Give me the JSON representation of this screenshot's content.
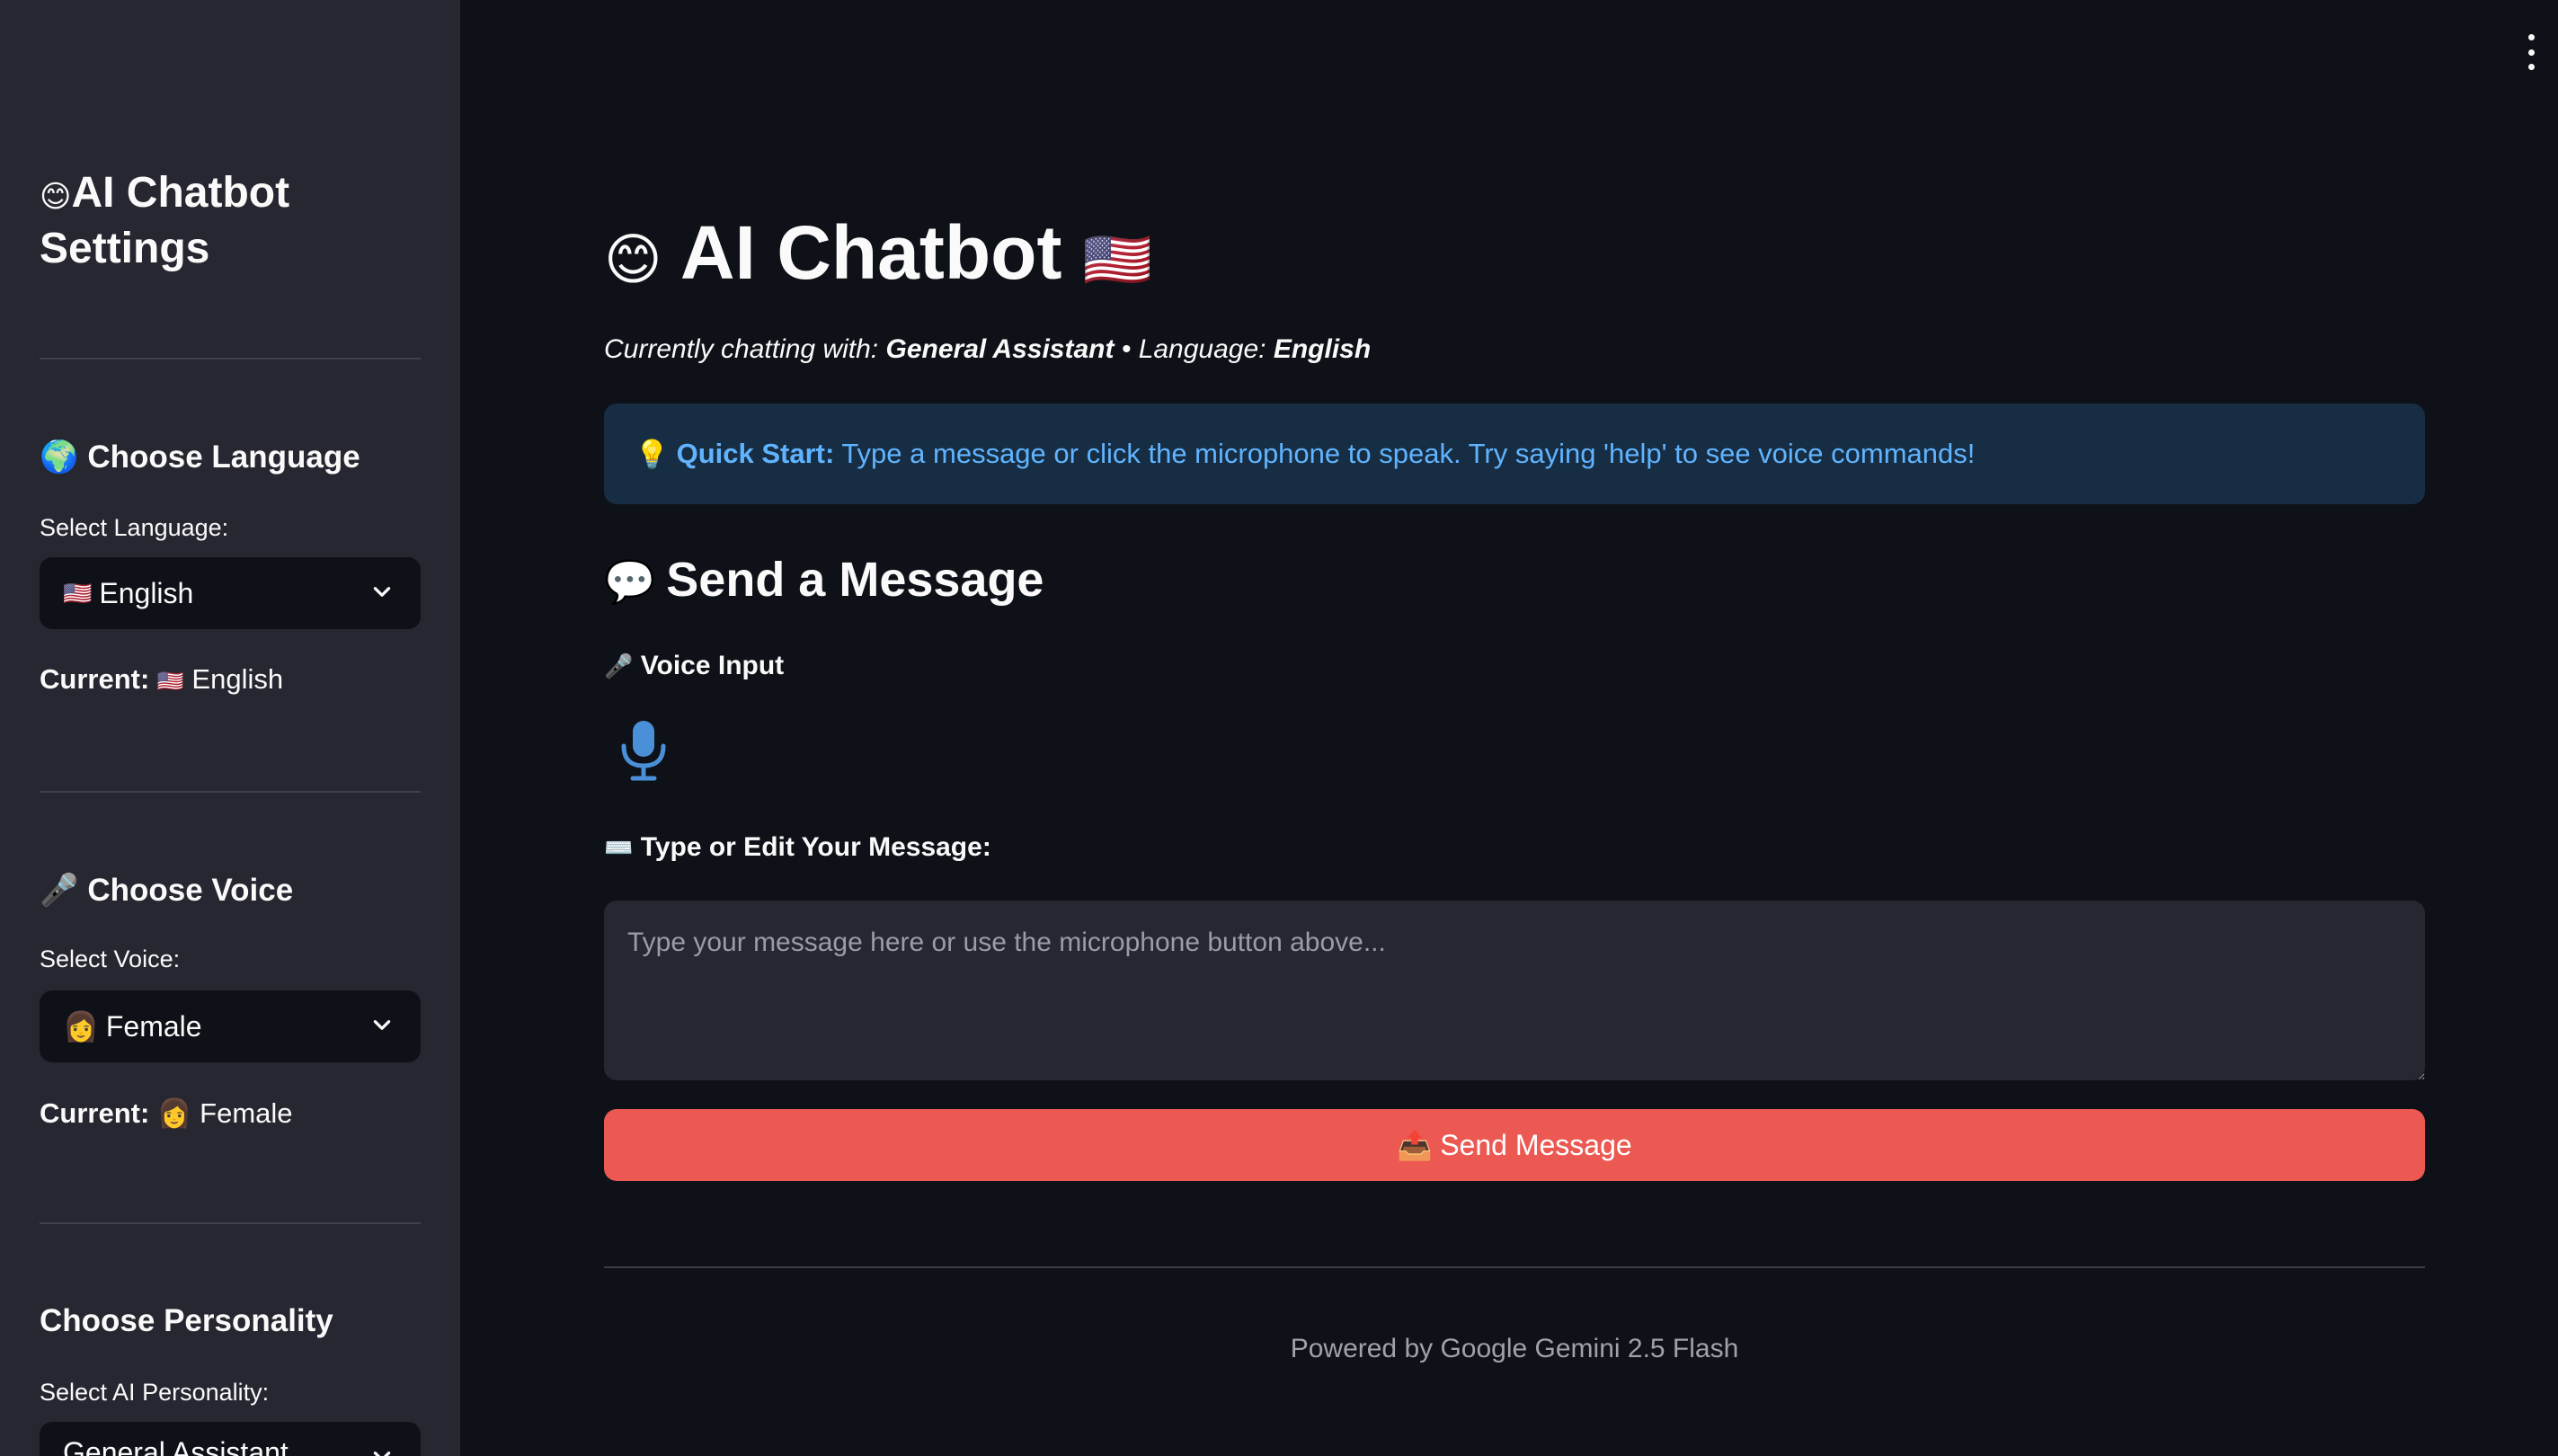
{
  "sidebar": {
    "title_emoji": "😊",
    "title": "AI Chatbot Settings",
    "language": {
      "emoji": "🌍",
      "heading": "Choose Language",
      "select_label": "Select Language:",
      "selected_flag": "🇺🇸",
      "selected": "English",
      "current_label": "Current:",
      "current_flag": "🇺🇸",
      "current_value": "English"
    },
    "voice": {
      "emoji": "🎤",
      "heading": "Choose Voice",
      "select_label": "Select Voice:",
      "selected_emoji": "👩",
      "selected": "Female",
      "current_label": "Current:",
      "current_emoji": "👩",
      "current_value": "Female"
    },
    "personality": {
      "heading": "Choose Personality",
      "select_label": "Select AI Personality:",
      "selected": "General Assistant"
    }
  },
  "main": {
    "title_emoji": "😊",
    "title": "AI Chatbot",
    "title_flag": "🇺🇸",
    "subtitle": {
      "prefix": "Currently chatting with:",
      "personality": "General Assistant",
      "separator": "•",
      "language_label": "Language:",
      "language": "English"
    },
    "info": {
      "emoji": "💡",
      "bold": "Quick Start:",
      "text": "Type a message or click the microphone to speak. Try saying 'help' to see voice commands!"
    },
    "send_section": {
      "emoji": "💬",
      "heading": "Send a Message",
      "voice_emoji": "🎤",
      "voice_label": "Voice Input",
      "type_emoji": "⌨️",
      "type_label": "Type or Edit Your Message:",
      "placeholder": "Type your message here or use the microphone button above...",
      "send_emoji": "📤",
      "send_label": "Send Message"
    },
    "footer": "Powered by Google Gemini 2.5 Flash"
  },
  "colors": {
    "background": "#0e1117",
    "sidebar": "#262730",
    "accent": "#ec5953",
    "info_bg": "#172d43",
    "info_text": "#60b4ff",
    "mic": "#4a90d9"
  },
  "icons": [
    "chevron-down-icon",
    "microphone-icon",
    "kebab-menu-icon"
  ]
}
